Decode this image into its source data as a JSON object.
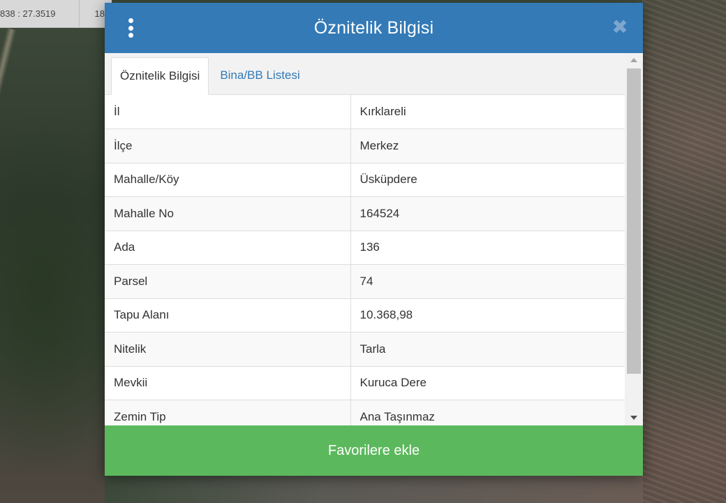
{
  "map": {
    "coordinates": [
      "838 : 27.3519",
      "18"
    ]
  },
  "modal": {
    "title": "Öznitelik Bilgisi",
    "tabs": [
      {
        "label": "Öznitelik Bilgisi",
        "active": true
      },
      {
        "label": "Bina/BB Listesi",
        "active": false
      }
    ],
    "rows": [
      {
        "key": "İl",
        "value": "Kırklareli"
      },
      {
        "key": "İlçe",
        "value": "Merkez"
      },
      {
        "key": "Mahalle/Köy",
        "value": "Üsküpdere"
      },
      {
        "key": "Mahalle No",
        "value": "164524"
      },
      {
        "key": "Ada",
        "value": "136"
      },
      {
        "key": "Parsel",
        "value": "74"
      },
      {
        "key": "Tapu Alanı",
        "value": "10.368,98"
      },
      {
        "key": "Nitelik",
        "value": "Tarla"
      },
      {
        "key": "Mevkii",
        "value": "Kuruca Dere"
      },
      {
        "key": "Zemin Tip",
        "value": "Ana Taşınmaz"
      }
    ],
    "footer_label": "Favorilere ekle"
  },
  "colors": {
    "header": "#337ab7",
    "footer": "#5cb85c",
    "tab_link": "#337ab7"
  },
  "icons": {
    "menu": "kebab-menu-icon",
    "close": "close-icon"
  }
}
